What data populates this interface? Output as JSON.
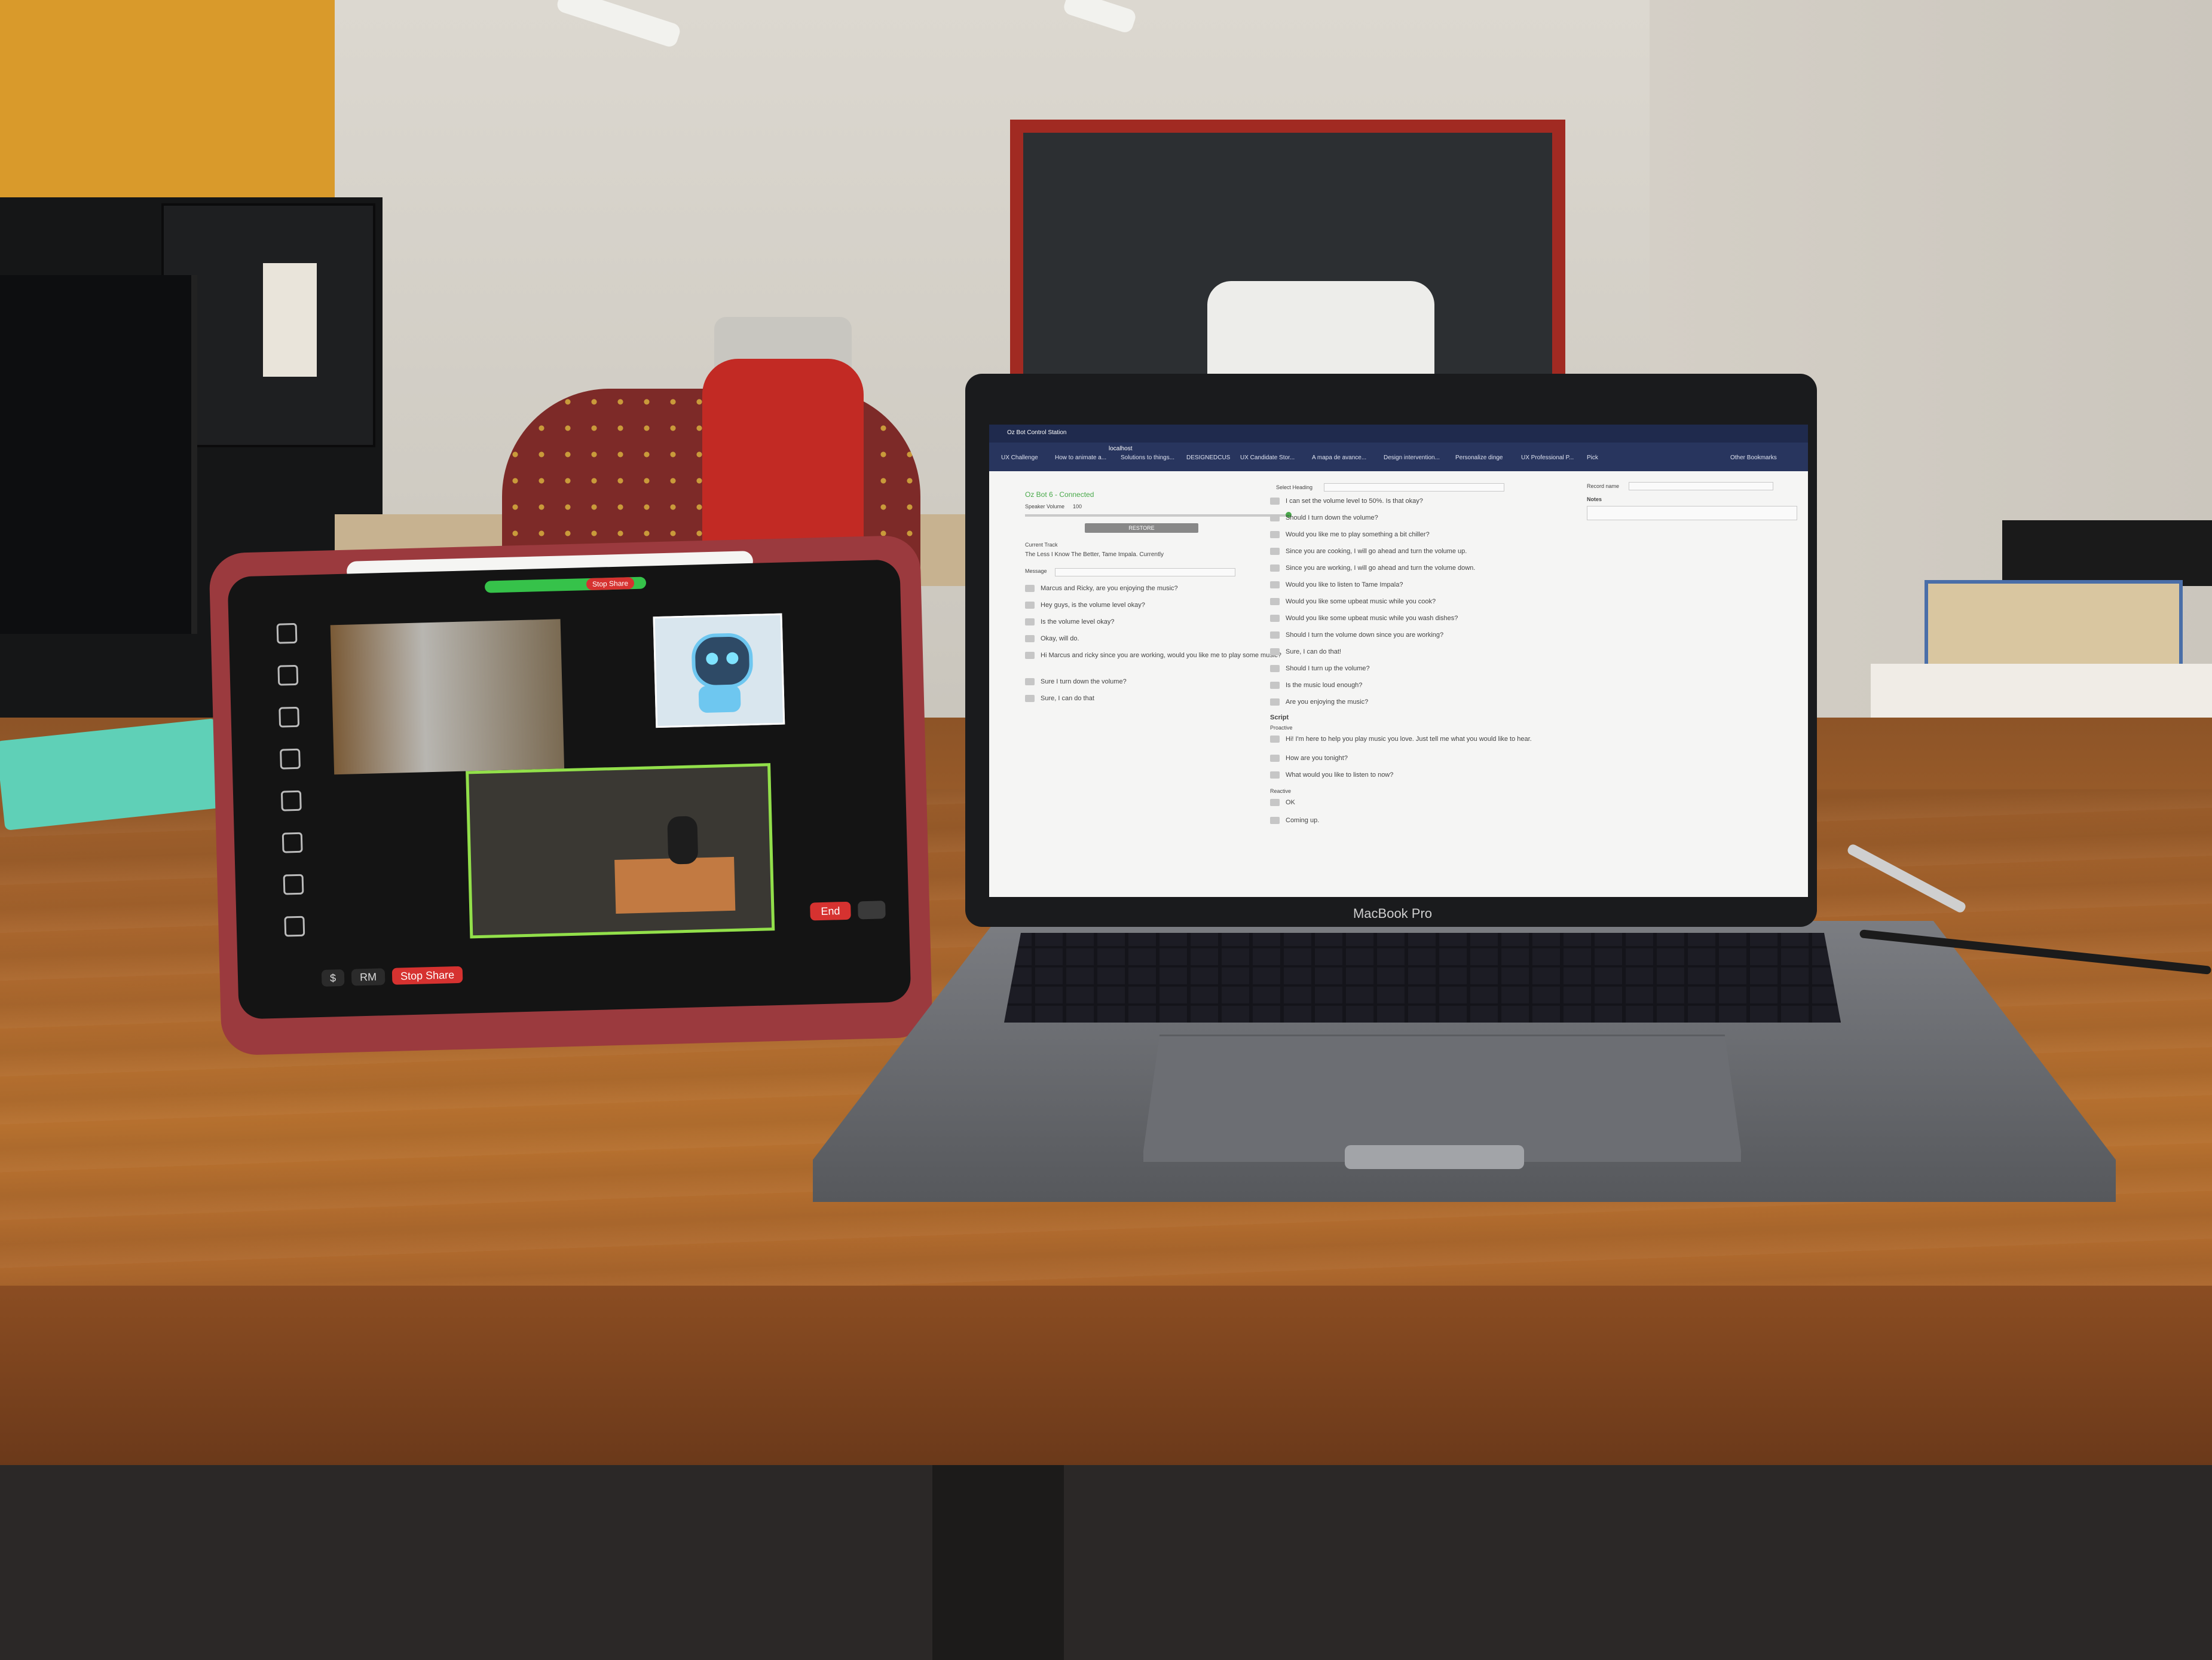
{
  "ipad": {
    "share_stop_label": "Stop Share",
    "stop_share_label": "Stop Share",
    "end_label": "End",
    "bottom_icon_label": "$",
    "bottom_mid_label": "RM"
  },
  "laptop": {
    "brand_label": "MacBook Pro",
    "browser": {
      "tab_title": "Oz Bot Control Station",
      "address": "localhost",
      "bookmarks": [
        "UX Challenge",
        "How to animate a...",
        "Solutions to things...",
        "DESIGNEDCUS",
        "UX Candidate Stor...",
        "A mapa de avance...",
        "Design intervention...",
        "Personalize dinge",
        "UX Professional P...",
        "Pick",
        "Other Bookmarks"
      ]
    },
    "left_panel": {
      "status": "Oz Bot 6 - Connected",
      "speaker_label": "Speaker Volume",
      "speaker_value": "100",
      "button_label": "RESTORE",
      "current_track_label": "Current Track",
      "current_track_value": "The Less I Know The Better, Tame Impala. Currently",
      "message_label": "Message",
      "utterances": [
        "Marcus and Ricky, are you enjoying the music?",
        "Hey guys, is the volume level okay?",
        "Is the volume level okay?",
        "Okay, will do.",
        "Hi Marcus and ricky since you are working, would you like me to play some music?",
        "Sure I turn down the volume?",
        "Sure, I can do that"
      ]
    },
    "middle_panel": {
      "header_label": "Select Heading",
      "utterances": [
        "I can set the volume level to 50%. Is that okay?",
        "Should I turn down the volume?",
        "Would you like me to play something a bit chiller?",
        "Since you are cooking, I will go ahead and turn the volume up.",
        "Since you are working, I will go ahead and turn the volume down.",
        "Would you like to listen to Tame Impala?",
        "Would you like some upbeat music while you cook?",
        "Would you like some upbeat music while you wash dishes?",
        "Should I turn the volume down since you are working?",
        "Sure, I can do that!",
        "Should I turn up the volume?",
        "Is the music loud enough?",
        "Are you enjoying the music?"
      ],
      "script_label": "Script",
      "proactive_label": "Proactive",
      "proactive_items": [
        "Hi! I'm here to help you play music you love. Just tell me what you would like to hear.",
        "How are you tonight?",
        "What would you like to listen to now?"
      ],
      "reactive_label": "Reactive",
      "reactive_items": [
        "OK",
        "Coming up."
      ]
    },
    "right_panel": {
      "record_label": "Record name",
      "notes_label": "Notes"
    }
  },
  "colors": {
    "table": "#a8652d",
    "ipad_case": "#9b3a3e",
    "bottle": "#c22a24",
    "connected_green": "#49a94a",
    "browser_bar": "#28355e"
  }
}
